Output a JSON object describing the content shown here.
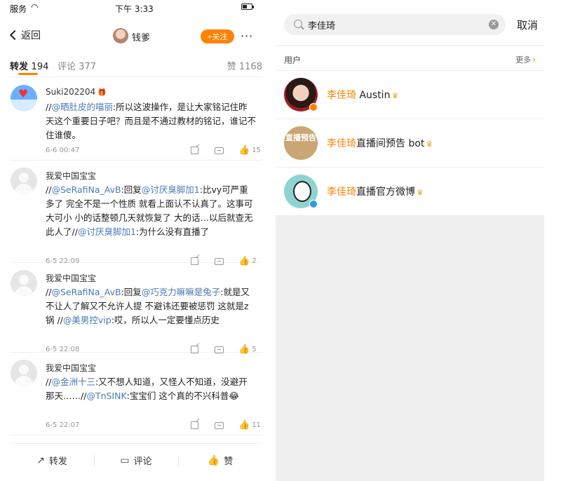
{
  "status": {
    "carrier": "服务",
    "time": "下午 3:33"
  },
  "nav": {
    "back_label": "返回",
    "title": "钱爹",
    "follow_label": "+关注",
    "more_label": "···"
  },
  "tabs": [
    {
      "label": "转发",
      "count": "194"
    },
    {
      "label": "评论",
      "count": "377"
    },
    {
      "label": "赞",
      "count": "1168"
    }
  ],
  "reposts": [
    {
      "user": "Suki202204",
      "text_parts": [
        "//",
        "@晒肚皮的喵丽",
        ":所以这波操作，是让大家铭记住昨天这个重要日子吧？而且是不通过教材的铭记，谁记不住谁傻。"
      ],
      "time": "6-6 00:47",
      "likes": "15"
    },
    {
      "user": "我爱中国宝宝",
      "text_parts": [
        "//",
        "@SeRafiNa_AvB",
        ":回复",
        "@讨厌臭脚加1",
        ":比vy可严重多了 完全不是一个性质 就看上面认不认真了。这事可大可小 小的话整顿几天就恢复了 大的话…以后就查无此人了//",
        "@讨厌臭脚加1",
        ":为什么没有直播了"
      ],
      "time": "6-5 22:09",
      "likes": "2"
    },
    {
      "user": "我爱中国宝宝",
      "text_parts": [
        "//",
        "@SeRafiNa_AvB",
        ":回复",
        "@巧克力嘛嘛是兔子",
        ":就是又不让人了解又不允许人提 不避讳还要被惩罚 这就是z锅 //",
        "@美男控vip",
        ":哎，所以人一定要懂点历史"
      ],
      "time": "6-5 22:08",
      "likes": "5"
    },
    {
      "user": "我爱中国宝宝",
      "text_parts": [
        "//",
        "@金洲十三",
        ":又不想人知道，又怪人不知道，没避开那天……//",
        "@TnSINK",
        ":宝宝们 这个真的不兴科普😂"
      ],
      "time": "6-5 22:07",
      "likes": "11"
    }
  ],
  "bottom": {
    "repost_label": "转发",
    "comment_label": "评论",
    "like_label": "赞"
  },
  "search": {
    "query": "李佳琦",
    "cancel_label": "取消"
  },
  "users_section": {
    "label": "用户",
    "more_label": "更多"
  },
  "users": [
    {
      "highlight": "李佳琦",
      "rest": " Austin",
      "avatar_text": ""
    },
    {
      "highlight": "李佳琦",
      "rest": "直播间预告 bot",
      "avatar_text": "直播预告"
    },
    {
      "highlight": "李佳琦",
      "rest": "直播官方微博",
      "avatar_text": ""
    }
  ],
  "colors": {
    "accent": "#ff8200",
    "mention": "#4a7ab8",
    "verify_blue": "#2d9cdb"
  },
  "icons": [
    "wifi-icon",
    "battery-icon",
    "chevron-left-icon",
    "more-dots-icon",
    "share-icon",
    "comment-icon",
    "like-icon",
    "search-icon",
    "clear-icon",
    "chevron-right-icon",
    "verified-icon",
    "crown-icon"
  ]
}
